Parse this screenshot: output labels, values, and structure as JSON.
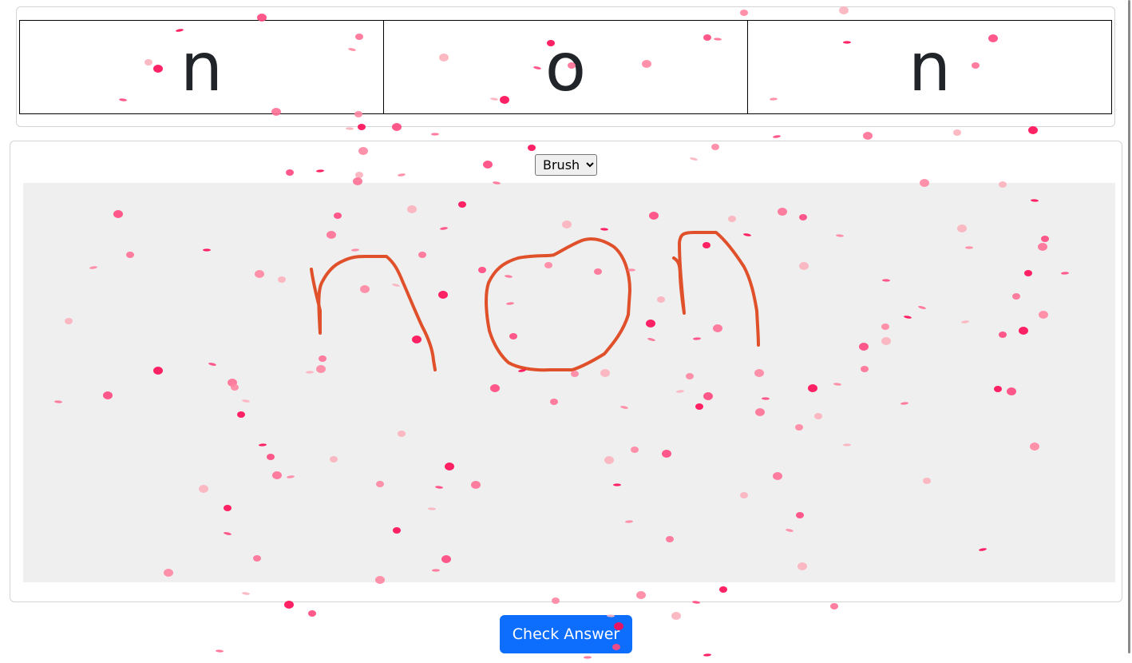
{
  "letters": [
    "n",
    "o",
    "n"
  ],
  "tool_select": {
    "selected": "Brush",
    "options": [
      "Brush"
    ]
  },
  "check_button_label": "Check Answer",
  "colors": {
    "accent_button": "#0d6efd",
    "stroke": "#e0502a",
    "canvas_background": "#efefef",
    "confetti": [
      "#ff0a54",
      "#ff477e",
      "#ff7096",
      "#ff85a1",
      "#fbb1bd"
    ]
  },
  "icons": {
    "select_arrow": "chevron-down-icon"
  }
}
